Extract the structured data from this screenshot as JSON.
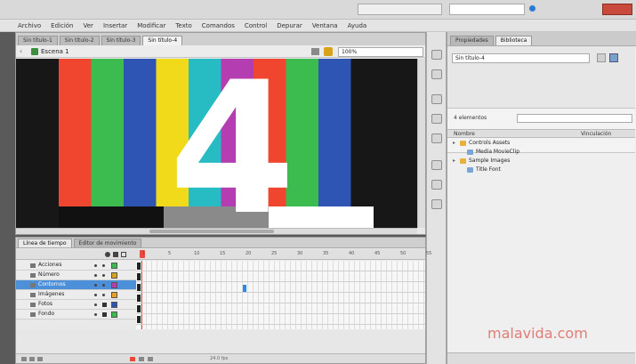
{
  "menu": [
    "Archivo",
    "Edición",
    "Ver",
    "Insertar",
    "Modificar",
    "Texto",
    "Comandos",
    "Control",
    "Depurar",
    "Ventana",
    "Ayuda"
  ],
  "doc_tabs": [
    "Sin título-1",
    "Sin título-2",
    "Sin título-3",
    "Sin título-4"
  ],
  "active_tab": 3,
  "edit_bar": {
    "back": "‹",
    "scene_label": "Escena 1",
    "zoom": "100%"
  },
  "stage": {
    "bars": [
      "#f0452e",
      "#3cbb4f",
      "#2f55b4",
      "#f0da1a",
      "#27bcc4",
      "#b53db2",
      "#f0452e",
      "#3cbb4f",
      "#2f55b4"
    ],
    "digit": "4"
  },
  "panel_tabs": [
    "Propiedades",
    "Biblioteca"
  ],
  "active_panel_tab": 1,
  "library": {
    "select": "Sin título-4",
    "count_label": "4 elementos",
    "col_name": "Nombre",
    "col_link": "Vinculación",
    "items": [
      {
        "label": "Controls Assets",
        "indent": 0,
        "folder": true
      },
      {
        "label": "Media MovieClip",
        "indent": 1,
        "folder": false
      },
      {
        "label": "Sample Images",
        "indent": 0,
        "folder": true
      },
      {
        "label": "Title Font",
        "indent": 1,
        "folder": false
      }
    ]
  },
  "timeline": {
    "tabs": [
      "Línea de tiempo",
      "Editor de movimiento"
    ],
    "frame_numbers": [
      "1",
      "5",
      "10",
      "15",
      "20",
      "25",
      "30",
      "35",
      "40",
      "45",
      "50",
      "55"
    ],
    "layers": [
      {
        "name": "Acciones",
        "color": "#3cbb4f",
        "selected": false
      },
      {
        "name": "Número",
        "color": "#d9a21b",
        "selected": false
      },
      {
        "name": "Contornos",
        "color": "#b53db2",
        "selected": true
      },
      {
        "name": "Imágenes",
        "color": "#f0a020",
        "selected": false
      },
      {
        "name": "Fotos",
        "color": "#2f55b4",
        "selected": false
      },
      {
        "name": "Fondo",
        "color": "#3cbb4f",
        "selected": false
      }
    ],
    "fps": "24.0 fps"
  },
  "watermark": "malavida.com"
}
